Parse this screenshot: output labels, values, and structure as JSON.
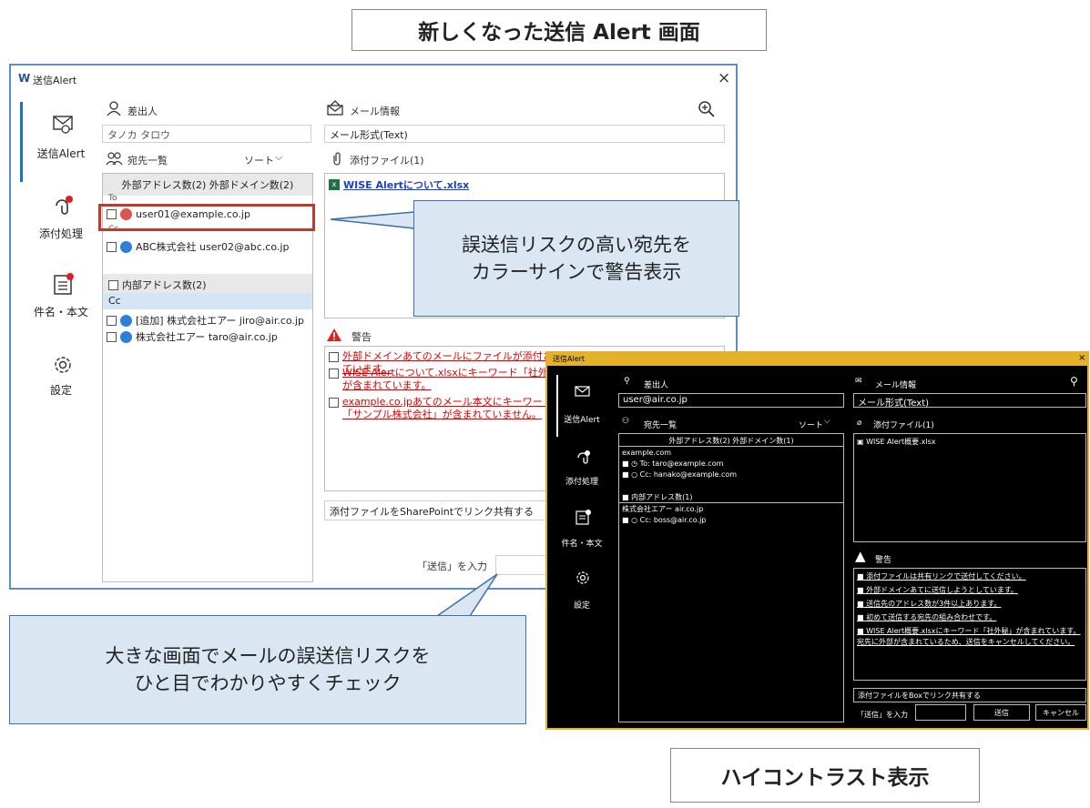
{
  "headings": {
    "new_screen": "新しくなった送信 Alert 画面",
    "high_contrast": "ハイコントラスト表示"
  },
  "callouts": {
    "risk": [
      "誤送信リスクの高い宛先を",
      "カラーサインで警告表示"
    ],
    "big_screen": [
      "大きな画面でメールの誤送信リスクを",
      "ひと目でわかりやすくチェック"
    ]
  },
  "light": {
    "window_title": "送信Alert",
    "logo": "W",
    "close": "×",
    "nav": [
      "送信Alert",
      "添付処理",
      "件名・本文",
      "設定"
    ],
    "sender_label": "差出人",
    "sender_value": "タノカ タロウ",
    "recipients_label": "宛先一覧",
    "sort_label": "ソート",
    "external_header": "外部アドレス数(2) 外部ドメイン数(2)",
    "to_label": "To",
    "cc_label": "Cc",
    "external_rows": [
      "user01@example.co.jp",
      "ABC株式会社 user02@abc.co.jp"
    ],
    "internal_header": "内部アドレス数(2)",
    "internal_rows": [
      "[追加] 株式会社エアー jiro@air.co.jp",
      "株式会社エアー taro@air.co.jp"
    ],
    "mail_info_label": "メール情報",
    "mail_format": "メール形式(Text)",
    "attach_label": "添付ファイル(1)",
    "attach_file": "WISE Alertについて.xlsx",
    "warning_label": "警告",
    "warnings": [
      "外部ドメインあてのメールにファイルが添付されています。",
      "WISE Alertについて.xlsxにキーワード「社外秘」が含まれています。",
      "example.co.jpあてのメール本文にキーワード「サンプル株式会社」が含まれていません。"
    ],
    "sharepoint_option": "添付ファイルをSharePointでリンク共有する",
    "send_prompt": "「送信」を入力"
  },
  "dark": {
    "window_title": "送信Alert",
    "close": "×",
    "nav": [
      "送信Alert",
      "添付処理",
      "件名・本文",
      "設定"
    ],
    "sender_label": "差出人",
    "sender_value": "user@air.co.jp",
    "recipients_label": "宛先一覧",
    "sort_label": "ソート",
    "external_header": "外部アドレス数(2) 外部ドメイン数(1)",
    "external_domain": "example.com",
    "external_rows": [
      "To: taro@example.com",
      "Cc: hanako@example.com"
    ],
    "internal_header": "内部アドレス数(1)",
    "internal_domain": "株式会社エアー air.co.jp",
    "internal_rows": [
      "Cc: boss@air.co.jp"
    ],
    "mail_info_label": "メール情報",
    "mail_format": "メール形式(Text)",
    "attach_label": "添付ファイル(1)",
    "attach_file": "WISE Alert概要.xlsx",
    "warning_label": "警告",
    "warnings": [
      "添付ファイルは共有リンクで送付してください。",
      "外部ドメインあてに送信しようとしています。",
      "送信先のアドレス数が3件以上あります。",
      "初めて送信する宛先の組み合わせです。",
      "WISE Alert概要.xlsxにキーワード「社外秘」が含まれています。宛先に外部が含まれているため、送信をキャンセルしてください。"
    ],
    "box_option": "添付ファイルをBoxでリンク共有する",
    "send_prompt": "「送信」を入力",
    "send_button": "送信",
    "cancel_button": "キャンセル"
  },
  "colors": {
    "risk_dot": "#e05252",
    "safe_dot": "#2f7fd8",
    "highlight_border": "#c0392b",
    "dark_accent": "#e3b12a",
    "callout_fill": "#dae7f3"
  }
}
